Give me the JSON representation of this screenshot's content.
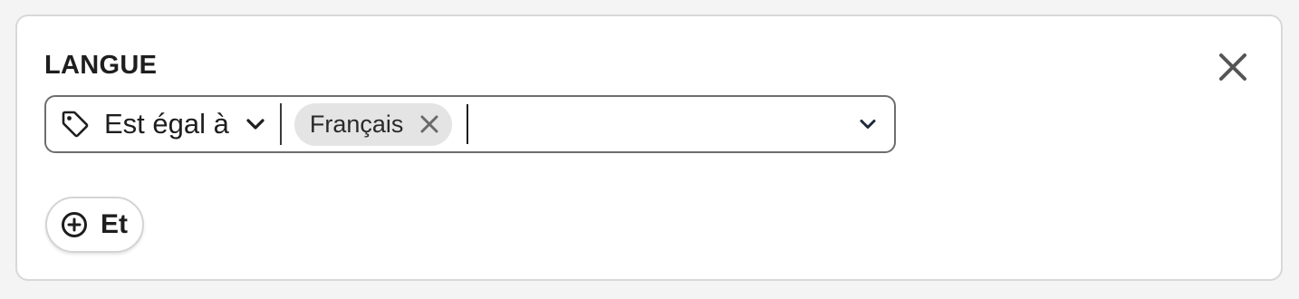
{
  "filter": {
    "title": "LANGUE",
    "operator_label": "Est égal à",
    "selected_values": [
      "Français"
    ],
    "input_value": ""
  },
  "actions": {
    "add_condition_label": "Et"
  },
  "icons": {
    "close": "close-icon",
    "tag": "tag-icon",
    "operator_dropdown": "chevron-down-icon",
    "chip_remove": "close-icon",
    "values_dropdown": "chevron-down-icon",
    "add": "plus-circle-icon"
  },
  "colors": {
    "text": "#1e1e1e",
    "chip_background": "#e4e4e4",
    "field_border": "#6e6e6e",
    "card_border": "#d8d8d8"
  }
}
